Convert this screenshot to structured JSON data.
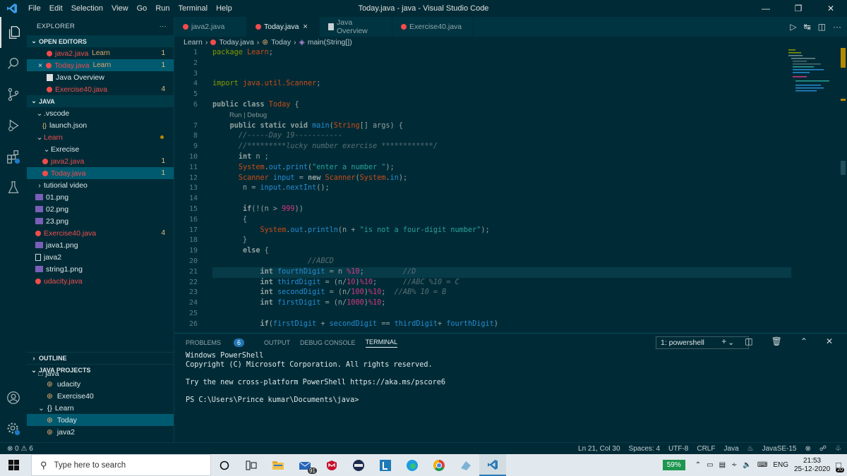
{
  "titlebar": {
    "menu": [
      "File",
      "Edit",
      "Selection",
      "View",
      "Go",
      "Run",
      "Terminal",
      "Help"
    ],
    "title": "Today.java - java - Visual Studio Code"
  },
  "activity_bar": [
    "explorer-icon",
    "search-icon",
    "source-control-icon",
    "run-debug-icon",
    "extensions-icon",
    "testing-icon",
    "accounts-icon",
    "settings-gear-icon"
  ],
  "sidebar": {
    "header": "EXPLORER",
    "more": "···",
    "open_editors_title": "OPEN EDITORS",
    "open_editors": [
      {
        "name": "java2.java",
        "annot": "Learn",
        "count": "1"
      },
      {
        "name": "Today.java",
        "annot": "Learn",
        "count": "1",
        "close": "×"
      },
      {
        "name": "Java Overview",
        "annot": "",
        "count": ""
      },
      {
        "name": "Exercise40.java",
        "annot": "",
        "count": "4"
      }
    ],
    "java_title": "JAVA",
    "tree": [
      {
        "name": ".vscode",
        "type": "folder",
        "indent": 1
      },
      {
        "name": "launch.json",
        "type": "json",
        "indent": 2
      },
      {
        "name": "Learn",
        "type": "folder",
        "indent": 1
      },
      {
        "name": "Exrecise",
        "type": "folder",
        "indent": 2
      },
      {
        "name": "java2.java",
        "type": "java-err",
        "indent": 2,
        "count": "1"
      },
      {
        "name": "Today.java",
        "type": "java-err",
        "indent": 2,
        "count": "1"
      },
      {
        "name": "tutiorial video",
        "type": "folder-closed",
        "indent": 1
      },
      {
        "name": "01.png",
        "type": "img",
        "indent": 1
      },
      {
        "name": "02.png",
        "type": "img",
        "indent": 1
      },
      {
        "name": "23.png",
        "type": "img",
        "indent": 1
      },
      {
        "name": "Exercise40.java",
        "type": "java-err",
        "indent": 1,
        "count": "4"
      },
      {
        "name": "java1.png",
        "type": "img",
        "indent": 1
      },
      {
        "name": "java2",
        "type": "file",
        "indent": 1
      },
      {
        "name": "string1.png",
        "type": "img",
        "indent": 1
      },
      {
        "name": "udacity.java",
        "type": "java-err",
        "indent": 1
      }
    ],
    "outline_title": "OUTLINE",
    "java_projects_title": "JAVA PROJECTS",
    "java_projects": [
      {
        "name": "java",
        "indent": 1
      },
      {
        "name": "udacity",
        "indent": 2
      },
      {
        "name": "Exercise40",
        "indent": 2
      },
      {
        "name": "Learn",
        "indent": 1,
        "icon": "{}"
      },
      {
        "name": "Today",
        "indent": 2
      },
      {
        "name": "java2",
        "indent": 2
      }
    ]
  },
  "tabs": [
    {
      "label": "java2.java"
    },
    {
      "label": "Today.java",
      "close": "×"
    },
    {
      "label": "Java Overview"
    },
    {
      "label": "Exercise40.java"
    }
  ],
  "breadcrumb": [
    "Learn",
    "Today.java",
    "Today",
    "main(String[])"
  ],
  "code": {
    "lines": [
      {
        "n": "1",
        "html": "<span class='pkg'>package</span> <span class='cls'>Learn</span>;"
      },
      {
        "n": "2",
        "html": ""
      },
      {
        "n": "3",
        "html": ""
      },
      {
        "n": "4",
        "html": "<span class='pkg'>import</span> <span class='cls'>java.util.Scanner</span>;"
      },
      {
        "n": "5",
        "html": ""
      },
      {
        "n": "6",
        "html": "<span class='kw'>public class</span> <span class='cls'>Today</span> {"
      },
      {
        "n": "",
        "lens": "Run | Debug"
      },
      {
        "n": "7",
        "html": "    <span class='kw'>public static void</span> <span class='fn'>main</span>(<span class='cls'>String</span>[] args) {"
      },
      {
        "n": "8",
        "html": "      <span class='cm'>//-----Day 19-----------</span>"
      },
      {
        "n": "9",
        "html": "      <span class='cm'>//*********lucky number exercise ************/</span>"
      },
      {
        "n": "10",
        "html": "      <span class='kw'>int</span> n ;"
      },
      {
        "n": "11",
        "html": "      <span class='cls'>System</span>.<span class='var'>out</span>.<span class='fn'>print</span>(<span class='str'>\"enter a number \"</span>);"
      },
      {
        "n": "12",
        "html": "      <span class='cls'>Scanner</span> <span class='var'>input</span> = <span class='kw'>new</span> <span class='cls'>Scanner</span>(<span class='cls'>System</span>.<span class='var'>in</span>);"
      },
      {
        "n": "13",
        "html": "       n = <span class='var'>input</span>.<span class='fn'>nextInt</span>();"
      },
      {
        "n": "14",
        "html": ""
      },
      {
        "n": "15",
        "html": "       <span class='kw'>if</span>(!(n &gt; <span class='num'>999</span>))"
      },
      {
        "n": "16",
        "html": "       {"
      },
      {
        "n": "17",
        "html": "           <span class='cls'>System</span>.<span class='var'>out</span>.<span class='fn'>println</span>(n + <span class='str'>\"is not a four-digit number\"</span>);"
      },
      {
        "n": "18",
        "html": "       }"
      },
      {
        "n": "19",
        "html": "       <span class='kw'>else</span> {"
      },
      {
        "n": "20",
        "html": "                      <span class='cm'>//ABCD</span>"
      },
      {
        "n": "21",
        "html": "           <span class='kw'>int</span> <span class='var'>fourthDigit</span> = n <span class='num'>%10</span>;         <span class='cm'>//D</span>",
        "hl": true
      },
      {
        "n": "22",
        "html": "           <span class='kw'>int</span> <span class='var'>thirdDigit</span> = (n/<span class='num'>10</span>)<span class='num'>%10</span>;      <span class='cm'>//ABC %10 = C</span>"
      },
      {
        "n": "23",
        "html": "           <span class='kw'>int</span> <span class='var'>secondDigit</span> = (n/<span class='num'>100</span>)<span class='num'>%10</span>;  <span class='cm'>//AB% 10 = B</span>"
      },
      {
        "n": "24",
        "html": "           <span class='kw'>int</span> <span class='var'>firstDigit</span> = (n/<span class='num'>1000</span>)<span class='num'>%10</span>;"
      },
      {
        "n": "25",
        "html": ""
      },
      {
        "n": "26",
        "html": "           <span class='kw'>if</span>(<span class='var'>firstDigit</span> + <span class='var'>secondDigit</span> == <span class='var'>thirdDigit</span>+ <span class='var'>fourthDigit</span>)"
      }
    ]
  },
  "panel": {
    "tabs": [
      {
        "label": "PROBLEMS",
        "badge": "6"
      },
      {
        "label": "OUTPUT"
      },
      {
        "label": "DEBUG CONSOLE"
      },
      {
        "label": "TERMINAL",
        "active": true
      }
    ],
    "terminal_select": "1: powershell",
    "terminal_lines": [
      "Windows PowerShell",
      "Copyright (C) Microsoft Corporation. All rights reserved.",
      "",
      "Try the new cross-platform PowerShell https://aka.ms/pscore6",
      "",
      "PS C:\\Users\\Prince kumar\\Documents\\java>"
    ]
  },
  "statusbar": {
    "errors": "0",
    "warnings": "6",
    "position": "Ln 21, Col 30",
    "spaces": "Spaces: 4",
    "encoding": "UTF-8",
    "eol": "CRLF",
    "language": "Java",
    "jdk": "JavaSE-15"
  },
  "taskbar": {
    "search_placeholder": "Type here to search",
    "mail_badge": "91",
    "battery": "59%",
    "lang": "ENG",
    "time": "21:53",
    "date": "25-12-2020",
    "notif": "20"
  },
  "colors": {
    "bg": "#002b36",
    "error": "#f14c4c",
    "accent": "#268bd2"
  }
}
